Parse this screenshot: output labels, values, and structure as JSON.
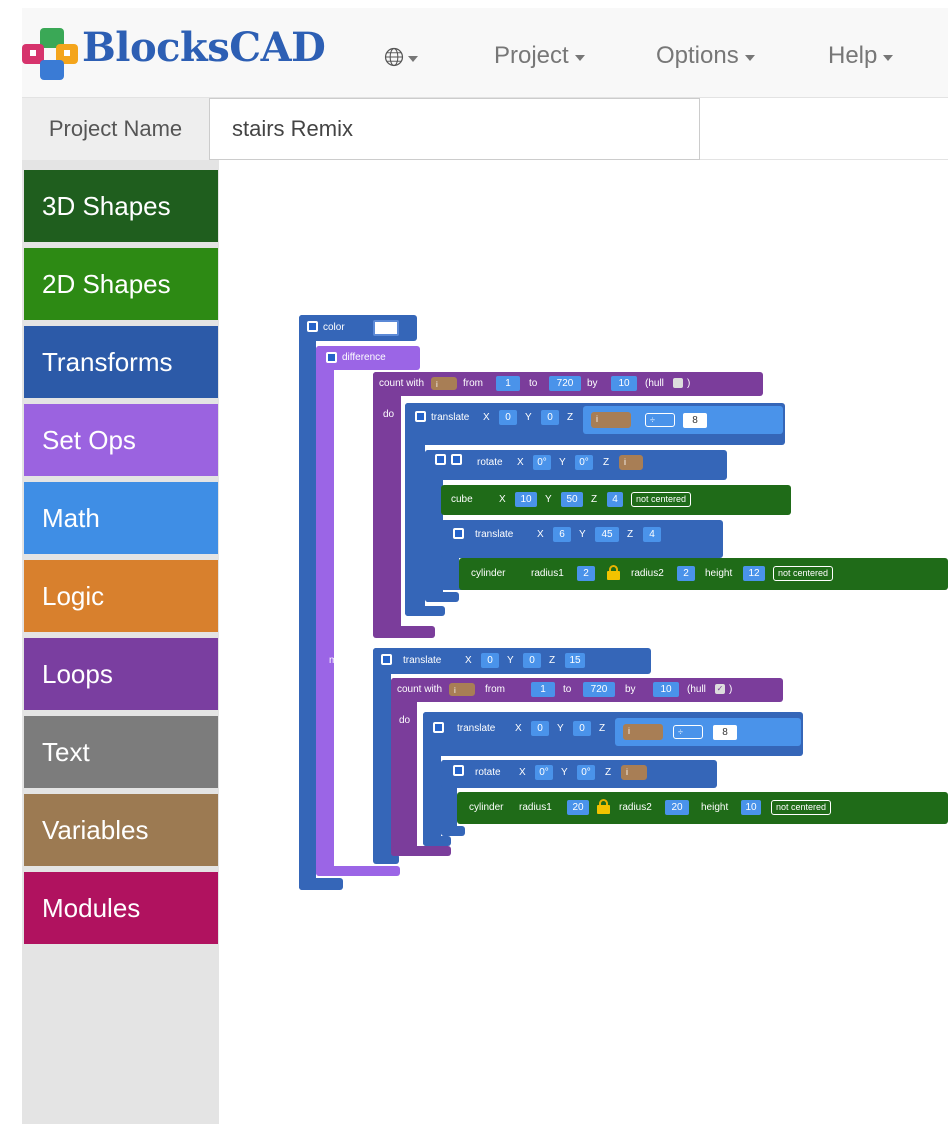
{
  "app": {
    "brand": "BlocksCAD"
  },
  "nav": {
    "project": "Project",
    "options": "Options",
    "help": "Help"
  },
  "project": {
    "label": "Project Name",
    "value": "stairs Remix"
  },
  "categories": [
    {
      "label": "3D Shapes",
      "color": "#1f5e1e"
    },
    {
      "label": "2D Shapes",
      "color": "#2d8a14"
    },
    {
      "label": "Transforms",
      "color": "#2c5aa8"
    },
    {
      "label": "Set Ops",
      "color": "#9b63e0"
    },
    {
      "label": "Math",
      "color": "#3f8ee5"
    },
    {
      "label": "Logic",
      "color": "#d8802d"
    },
    {
      "label": "Loops",
      "color": "#7a3ea0"
    },
    {
      "label": "Text",
      "color": "#7c7c7c"
    },
    {
      "label": "Variables",
      "color": "#9c7a52"
    },
    {
      "label": "Modules",
      "color": "#b0125f"
    }
  ],
  "colors": {
    "transform": "#3566b8",
    "setop": "#9b65e6",
    "loop": "#7b3d9b",
    "shape3d": "#1f6b18",
    "variable": "#a87e55",
    "math": "#3f8ee5"
  },
  "blocks": {
    "color": {
      "label": "color"
    },
    "difference": {
      "label": "difference",
      "minus": "minus"
    },
    "loop1": {
      "count_with": "count with",
      "var": "i",
      "from": "from",
      "from_v": "1",
      "to": "to",
      "to_v": "720",
      "by": "by",
      "by_v": "10",
      "hull": "(hull",
      "hull_close": ")",
      "do": "do"
    },
    "translate1": {
      "label": "translate",
      "x": "X",
      "x_v": "0",
      "y": "Y",
      "y_v": "0",
      "z": "Z",
      "var": "i",
      "op": "÷",
      "op_v": "8"
    },
    "rotate1": {
      "label": "rotate",
      "x": "X",
      "x_v": "0°",
      "y": "Y",
      "y_v": "0°",
      "z": "Z",
      "var": "i"
    },
    "cube": {
      "label": "cube",
      "x": "X",
      "x_v": "10",
      "y": "Y",
      "y_v": "50",
      "z": "Z",
      "z_v": "4",
      "center": "not centered"
    },
    "translate2": {
      "label": "translate",
      "x": "X",
      "x_v": "6",
      "y": "Y",
      "y_v": "45",
      "z": "Z",
      "z_v": "4"
    },
    "cylinder1": {
      "label": "cylinder",
      "r1": "radius1",
      "r1_v": "2",
      "r2": "radius2",
      "r2_v": "2",
      "h": "height",
      "h_v": "12",
      "center": "not centered"
    },
    "translate3": {
      "label": "translate",
      "x": "X",
      "x_v": "0",
      "y": "Y",
      "y_v": "0",
      "z": "Z",
      "z_v": "15"
    },
    "loop2": {
      "count_with": "count with",
      "var": "i",
      "from": "from",
      "from_v": "1",
      "to": "to",
      "to_v": "720",
      "by": "by",
      "by_v": "10",
      "hull": "(hull",
      "hull_close": ")",
      "do": "do"
    },
    "translate4": {
      "label": "translate",
      "x": "X",
      "x_v": "0",
      "y": "Y",
      "y_v": "0",
      "z": "Z",
      "var": "i",
      "op": "÷",
      "op_v": "8"
    },
    "rotate2": {
      "label": "rotate",
      "x": "X",
      "x_v": "0°",
      "y": "Y",
      "y_v": "0°",
      "z": "Z",
      "var": "i"
    },
    "cylinder2": {
      "label": "cylinder",
      "r1": "radius1",
      "r1_v": "20",
      "r2": "radius2",
      "r2_v": "20",
      "h": "height",
      "h_v": "10",
      "center": "not centered"
    }
  }
}
